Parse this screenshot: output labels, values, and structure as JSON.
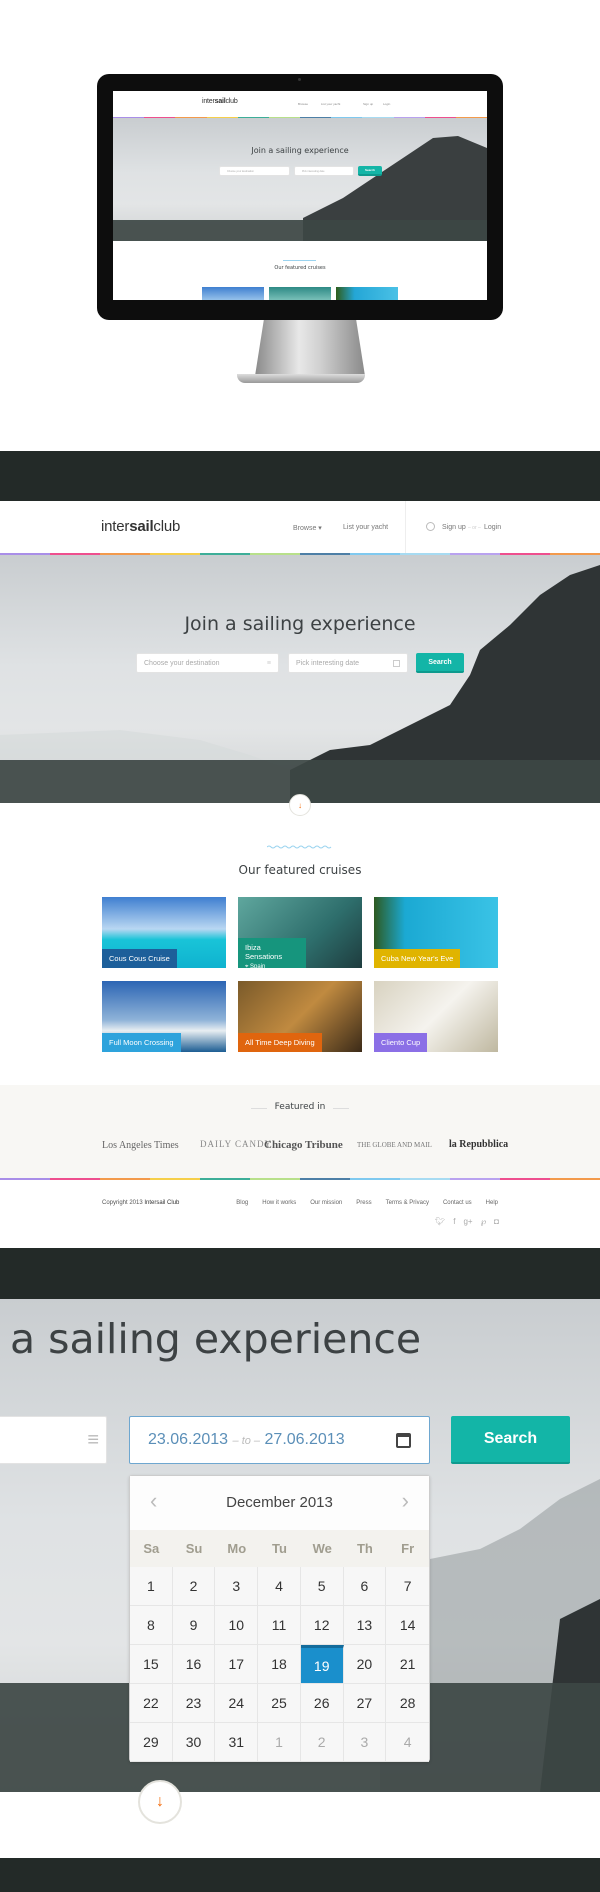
{
  "brand": {
    "pre": "inter",
    "bold": "sail",
    "post": "club"
  },
  "nav": {
    "browse": "Browse",
    "browse_caret": "▾",
    "list_yacht": "List your yacht",
    "sign_up": "Sign up",
    "or": "– or –",
    "login": "Login"
  },
  "hero": {
    "title": "Join a sailing experience",
    "title_partial": "a sailing experience",
    "destination_placeholder": "Choose your destination",
    "date_placeholder": "Pick interesting date",
    "search": "Search"
  },
  "date_range": {
    "from": "23.06.2013",
    "sep": "– to –",
    "to": "27.06.2013"
  },
  "calendar": {
    "month": "December 2013",
    "prev": "‹",
    "next": "›",
    "days": [
      "Sa",
      "Su",
      "Mo",
      "Tu",
      "We",
      "Th",
      "Fr"
    ],
    "cells": [
      "1",
      "2",
      "3",
      "4",
      "5",
      "6",
      "7",
      "8",
      "9",
      "10",
      "11",
      "12",
      "13",
      "14",
      "15",
      "16",
      "17",
      "18",
      "19",
      "20",
      "21",
      "22",
      "23",
      "24",
      "25",
      "26",
      "27",
      "28",
      "29",
      "30",
      "31",
      "1",
      "2",
      "3",
      "4"
    ],
    "selected": "19",
    "trailing_out_of_month": 4
  },
  "featured": {
    "title": "Our featured cruises",
    "cards": [
      {
        "title": "Cous Cous Cruise",
        "color": "#1d5f9a"
      },
      {
        "title": "Ibiza Sensations",
        "location": "Spain",
        "color": "#16957d"
      },
      {
        "title": "Cuba New Year's Eve",
        "color": "#e0b400"
      },
      {
        "title": "Full Moon Crossing",
        "color": "#2ea3dc"
      },
      {
        "title": "All Time Deep Diving",
        "color": "#e0650e"
      },
      {
        "title": "Cliento Cup",
        "color": "#8b6fe6"
      }
    ]
  },
  "press": {
    "title": "Featured in",
    "logos": [
      "Los Angeles Times",
      "DAILY CANDY",
      "Chicago Tribune",
      "THE GLOBE AND MAIL",
      "la Repubblica"
    ]
  },
  "footer": {
    "copyright_pre": "Copyright 2013",
    "copyright_name": "Intersail Club",
    "links": [
      "Blog",
      "How it works",
      "Our mission",
      "Press",
      "Terms & Privacy",
      "Contact us",
      "Help"
    ],
    "social": [
      "twitter-icon",
      "facebook-icon",
      "google-plus-icon",
      "pinterest-icon",
      "instagram-icon"
    ]
  },
  "colors": {
    "accent": "#13b5a7",
    "selected_day": "#1a8fcc",
    "arrow": "#f26a0a",
    "stripe": [
      "#a98ee8",
      "#ee4f8e",
      "#f39a4b",
      "#f6cf4a",
      "#3dae98",
      "#b8e08a",
      "#4d7fa6",
      "#7fc9ef",
      "#a7dbf2",
      "#b9a2ef",
      "#ee4f8e",
      "#f39a4b"
    ]
  }
}
